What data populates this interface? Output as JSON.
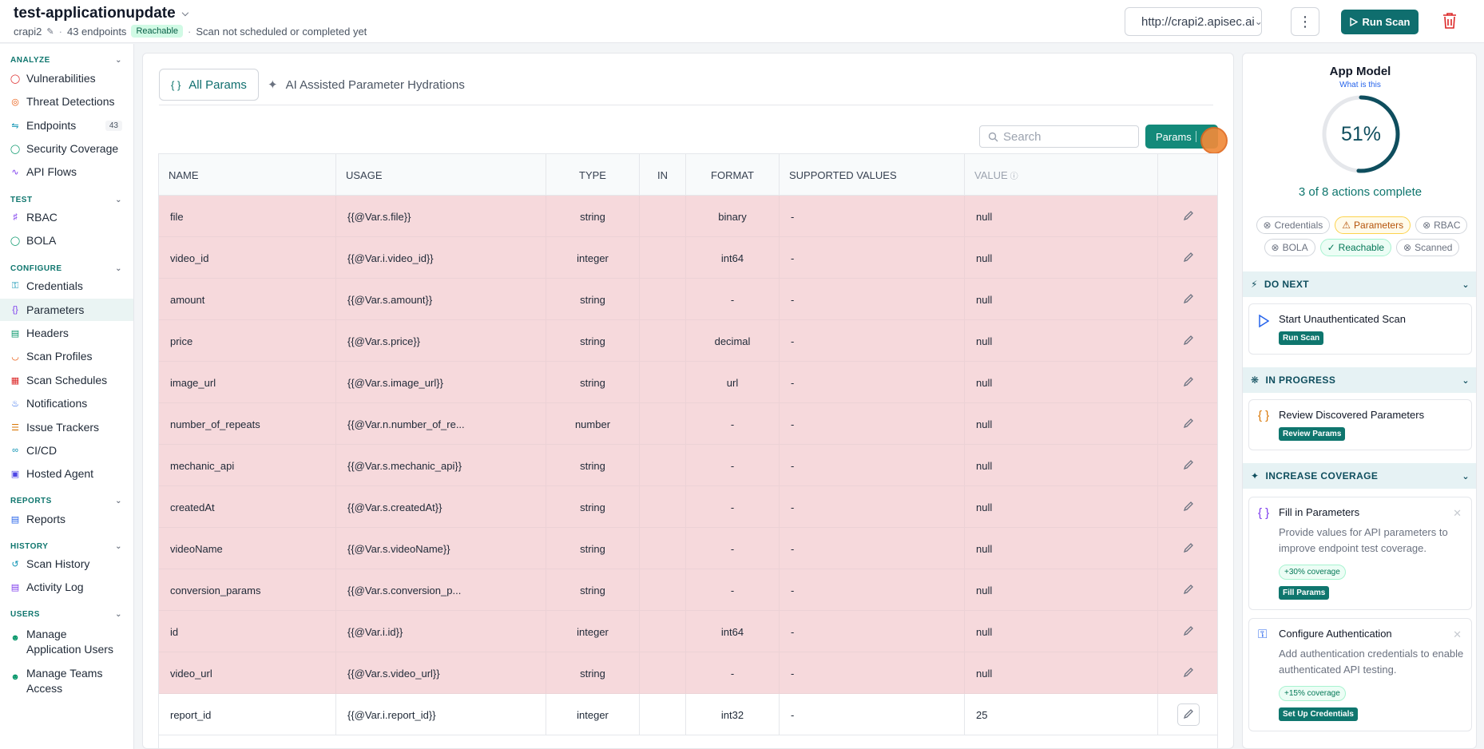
{
  "header": {
    "app_name": "test-applicationupdate",
    "owner": "crapi2",
    "endpoints": "43 endpoints",
    "status_badge": "Reachable",
    "scan_status": "Scan not scheduled or completed yet",
    "url": "http://crapi2.apisec.ai",
    "run_scan_label": "Run Scan"
  },
  "sidebar": {
    "analyze": "ANALYZE",
    "test": "TEST",
    "configure": "CONFIGURE",
    "reports": "REPORTS",
    "history": "HISTORY",
    "users": "USERS",
    "items": {
      "vulnerabilities": "Vulnerabilities",
      "threat_detections": "Threat Detections",
      "endpoints": "Endpoints",
      "endpoints_count": "43",
      "security_coverage": "Security Coverage",
      "api_flows": "API Flows",
      "rbac": "RBAC",
      "bola": "BOLA",
      "credentials": "Credentials",
      "parameters": "Parameters",
      "headers": "Headers",
      "scan_profiles": "Scan Profiles",
      "scan_schedules": "Scan Schedules",
      "notifications": "Notifications",
      "issue_trackers": "Issue Trackers",
      "cicd": "CI/CD",
      "hosted_agent": "Hosted Agent",
      "reports": "Reports",
      "scan_history": "Scan History",
      "activity_log": "Activity Log",
      "manage_app_users": "Manage Application Users",
      "manage_teams": "Manage Teams Access"
    }
  },
  "main": {
    "tabs": [
      {
        "label": "All Params",
        "icon": "{ }"
      },
      {
        "label": "AI Assisted Parameter Hydrations"
      }
    ],
    "search_placeholder": "Search",
    "params_button": "Params",
    "columns": [
      "NAME",
      "USAGE",
      "TYPE",
      "IN",
      "FORMAT",
      "SUPPORTED VALUES",
      "VALUE"
    ],
    "rows": [
      {
        "name": "file",
        "usage": "{{@Var.s.file}}",
        "type": "string",
        "in": "",
        "format": "binary",
        "supported": "-",
        "value": "null",
        "missing": true
      },
      {
        "name": "video_id",
        "usage": "{{@Var.i.video_id}}",
        "type": "integer",
        "in": "",
        "format": "int64",
        "supported": "-",
        "value": "null",
        "missing": true
      },
      {
        "name": "amount",
        "usage": "{{@Var.s.amount}}",
        "type": "string",
        "in": "",
        "format": "-",
        "supported": "-",
        "value": "null",
        "missing": true
      },
      {
        "name": "price",
        "usage": "{{@Var.s.price}}",
        "type": "string",
        "in": "",
        "format": "decimal",
        "supported": "-",
        "value": "null",
        "missing": true
      },
      {
        "name": "image_url",
        "usage": "{{@Var.s.image_url}}",
        "type": "string",
        "in": "",
        "format": "url",
        "supported": "-",
        "value": "null",
        "missing": true
      },
      {
        "name": "number_of_repeats",
        "usage": "{{@Var.n.number_of_re...",
        "type": "number",
        "in": "",
        "format": "-",
        "supported": "-",
        "value": "null",
        "missing": true
      },
      {
        "name": "mechanic_api",
        "usage": "{{@Var.s.mechanic_api}}",
        "type": "string",
        "in": "",
        "format": "-",
        "supported": "-",
        "value": "null",
        "missing": true
      },
      {
        "name": "createdAt",
        "usage": "{{@Var.s.createdAt}}",
        "type": "string",
        "in": "",
        "format": "-",
        "supported": "-",
        "value": "null",
        "missing": true
      },
      {
        "name": "videoName",
        "usage": "{{@Var.s.videoName}}",
        "type": "string",
        "in": "",
        "format": "-",
        "supported": "-",
        "value": "null",
        "missing": true
      },
      {
        "name": "conversion_params",
        "usage": "{{@Var.s.conversion_p...",
        "type": "string",
        "in": "",
        "format": "-",
        "supported": "-",
        "value": "null",
        "missing": true
      },
      {
        "name": "id",
        "usage": "{{@Var.i.id}}",
        "type": "integer",
        "in": "",
        "format": "int64",
        "supported": "-",
        "value": "null",
        "missing": true
      },
      {
        "name": "video_url",
        "usage": "{{@Var.s.video_url}}",
        "type": "string",
        "in": "",
        "format": "-",
        "supported": "-",
        "value": "null",
        "missing": true
      },
      {
        "name": "report_id",
        "usage": "{{@Var.i.report_id}}",
        "type": "integer",
        "in": "",
        "format": "int32",
        "supported": "-",
        "value": "25",
        "missing": false
      }
    ]
  },
  "app_model": {
    "title": "App Model",
    "what_is_this": "What is this",
    "percent": "51%",
    "percent_value": 51,
    "actions_complete": "3 of 8 actions complete",
    "chips": [
      {
        "label": "Credentials",
        "state": "none"
      },
      {
        "label": "Parameters",
        "state": "warn"
      },
      {
        "label": "RBAC",
        "state": "none"
      },
      {
        "label": "BOLA",
        "state": "none"
      },
      {
        "label": "Reachable",
        "state": "done"
      },
      {
        "label": "Scanned",
        "state": "none"
      }
    ],
    "do_next": {
      "heading": "DO NEXT",
      "card_title": "Start Unauthenticated Scan",
      "button": "Run Scan"
    },
    "in_progress": {
      "heading": "IN PROGRESS",
      "card_title": "Review Discovered Parameters",
      "button": "Review Params"
    },
    "increase_coverage": {
      "heading": "INCREASE COVERAGE",
      "cards": [
        {
          "title": "Fill in Parameters",
          "desc": "Provide values for API parameters to improve endpoint test coverage.",
          "coverage": "+30% coverage",
          "button": "Fill Params"
        },
        {
          "title": "Configure Authentication",
          "desc": "Add authentication credentials to enable authenticated API testing.",
          "coverage": "+15% coverage",
          "button": "Set Up Credentials"
        }
      ]
    }
  },
  "colors": {
    "accent": "#0f766e",
    "missing_row": "#f6d9dc",
    "danger": "#dc2626"
  }
}
